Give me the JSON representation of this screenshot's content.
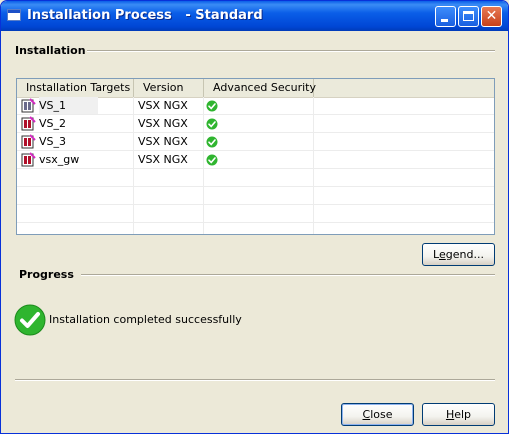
{
  "window": {
    "title": "Installation Process   - Standard"
  },
  "installation": {
    "section_label": "Installation",
    "columns": [
      "Installation Targets",
      "Version",
      "Advanced Security"
    ],
    "rows": [
      {
        "target": "VS_1",
        "version": "VSX NGX",
        "security_status": "ok"
      },
      {
        "target": "VS_2",
        "version": "VSX NGX",
        "security_status": "ok"
      },
      {
        "target": "VS_3",
        "version": "VSX NGX",
        "security_status": "ok"
      },
      {
        "target": "vsx_gw",
        "version": "VSX NGX",
        "security_status": "ok"
      }
    ],
    "legend_button": {
      "prefix": "L",
      "underlined": "e",
      "suffix": "gend..."
    }
  },
  "progress": {
    "section_label": "Progress",
    "status_text": "Installation completed successfully"
  },
  "footer": {
    "close_button": {
      "underlined": "C",
      "suffix": "lose"
    },
    "help_button": {
      "underlined": "H",
      "suffix": "elp"
    }
  },
  "colors": {
    "success": "#2fb52f",
    "titlebar": "#0a5ee8"
  },
  "icons": {
    "title": "window-icon",
    "target": "gateway-icon",
    "security": "green-check-icon",
    "status": "success-check-icon"
  }
}
